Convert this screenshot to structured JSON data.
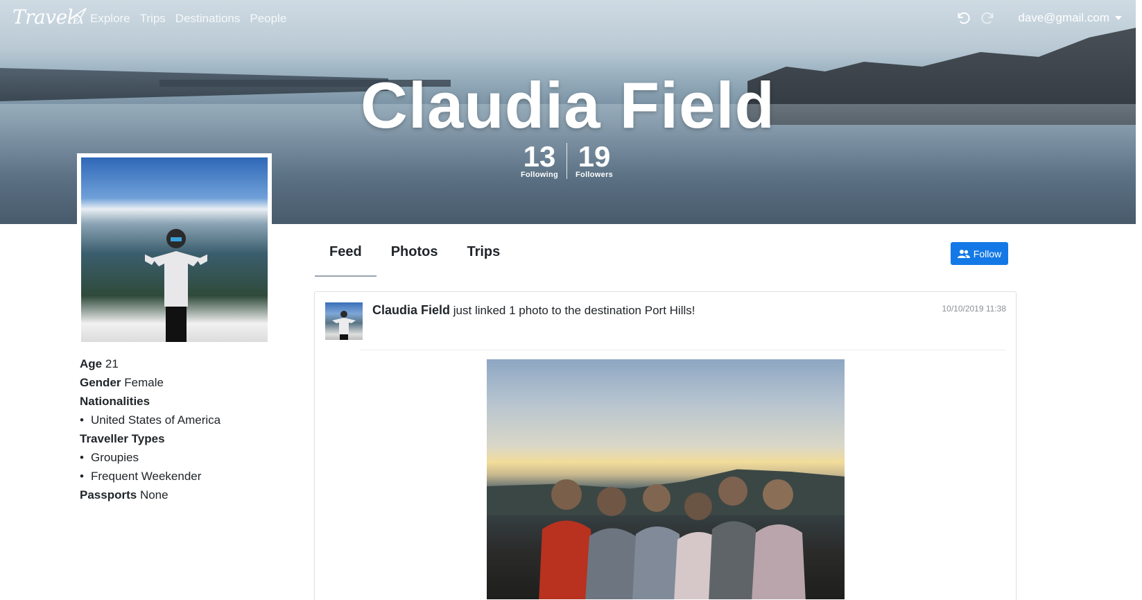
{
  "navbar": {
    "brand": "Travel",
    "brand_suffix": "EA",
    "links": [
      "Explore",
      "Trips",
      "Destinations",
      "People"
    ],
    "user_email": "dave@gmail.com"
  },
  "profile": {
    "name": "Claudia Field",
    "following_count": "13",
    "following_label": "Following",
    "followers_count": "19",
    "followers_label": "Followers"
  },
  "info": {
    "age_label": "Age",
    "age": "21",
    "gender_label": "Gender",
    "gender": "Female",
    "nationalities_label": "Nationalities",
    "nationalities": [
      "United States of America"
    ],
    "traveller_types_label": "Traveller Types",
    "traveller_types": [
      "Groupies",
      "Frequent Weekender"
    ],
    "passports_label": "Passports",
    "passports": "None"
  },
  "tabs": [
    "Feed",
    "Photos",
    "Trips"
  ],
  "follow_button": "Follow",
  "feed": {
    "author": "Claudia Field",
    "message": "just linked 1 photo to the destination Port Hills!",
    "timestamp": "10/10/2019 11:38"
  },
  "colors": {
    "primary": "#1479e6",
    "text": "#212529",
    "muted": "#8a9096"
  }
}
